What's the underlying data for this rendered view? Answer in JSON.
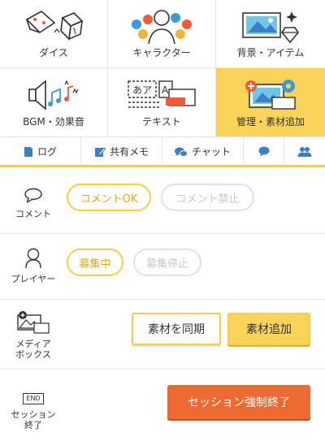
{
  "menu": {
    "dice": "ダイス",
    "character": "キャラクター",
    "background_items": "背景・アイテム",
    "bgm_sound": "BGM・効果音",
    "text": "テキスト",
    "manage_add": "管理・素材追加"
  },
  "tabs": {
    "log": "ログ",
    "shared_memo": "共有メモ",
    "chat": "チャット"
  },
  "comment": {
    "label": "コメント",
    "ok": "コメントOK",
    "forbid": "コメント禁止"
  },
  "player": {
    "label": "プレイヤー",
    "recruiting": "募集中",
    "stopped": "募集停止"
  },
  "media_box": {
    "label_line1": "メディア",
    "label_line2": "ボックス",
    "sync": "素材を同期",
    "add": "素材追加"
  },
  "session_end": {
    "icon_text": "END",
    "label_line1": "セッション",
    "label_line2": "終了",
    "force_end": "セッション強制終了"
  },
  "colors": {
    "accent_yellow": "#f9d35a",
    "border_yellow": "#f6cd45",
    "danger_orange": "#ee6a33",
    "icon_blue": "#3d7fc4"
  }
}
